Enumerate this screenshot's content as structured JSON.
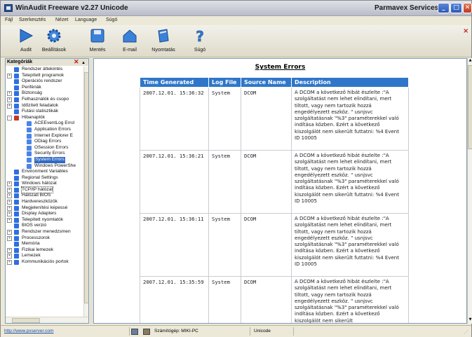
{
  "window": {
    "title": "WinAudit Freeware v2.27 Unicode",
    "vendor": "Parmavex Services",
    "buttons": {
      "minimize": "_",
      "maximize": "□",
      "close": "✕"
    }
  },
  "menu": [
    "Fájl",
    "Szerkesztés",
    "Nézet",
    "Language",
    "Súgó"
  ],
  "toolbar": {
    "items": [
      {
        "label": "Audit",
        "icon": "play-arrow-icon"
      },
      {
        "label": "Beállítások",
        "icon": "gear-icon"
      },
      {
        "label": "Mentés",
        "icon": "save-disk-icon"
      },
      {
        "label": "E-mail",
        "icon": "mail-house-icon"
      },
      {
        "label": "Nyomtatás",
        "icon": "printer-icon"
      },
      {
        "label": "Súgó",
        "icon": "help-question-icon"
      }
    ],
    "close_glyph": "×"
  },
  "sidebar": {
    "header": "Kategóriák",
    "close_glyph": "✕",
    "items": [
      {
        "label": "Rendszer áttekintés",
        "expander": ""
      },
      {
        "label": "Telepített programok",
        "expander": "+"
      },
      {
        "label": "Operációs rendszer",
        "expander": ""
      },
      {
        "label": "Perifériák",
        "expander": ""
      },
      {
        "label": "Biztonság",
        "expander": "+"
      },
      {
        "label": "Felhasználók és csopo",
        "expander": "+"
      },
      {
        "label": "Időzített feladatok",
        "expander": "+"
      },
      {
        "label": "Futási statisztikák",
        "expander": ""
      },
      {
        "label": "Hibanaplók",
        "expander": "-"
      },
      {
        "label": "ACEEventLog Errol",
        "expander": "",
        "indent": 1
      },
      {
        "label": "Application Errors",
        "expander": "",
        "indent": 1
      },
      {
        "label": "Internet Explorer E",
        "expander": "",
        "indent": 1
      },
      {
        "label": "ODiag Errors",
        "expander": "",
        "indent": 1
      },
      {
        "label": "OSession Errors",
        "expander": "",
        "indent": 1
      },
      {
        "label": "Security Errors",
        "expander": "",
        "indent": 1
      },
      {
        "label": "System Errors",
        "expander": "",
        "indent": 1,
        "selected": true
      },
      {
        "label": "Windows PowerShe",
        "expander": "",
        "indent": 1
      },
      {
        "label": "Environment Variables",
        "expander": ""
      },
      {
        "label": "Regional Settings",
        "expander": ""
      },
      {
        "label": "Windows hálózat",
        "expander": "+"
      },
      {
        "label": "TCP/IP hálózat",
        "expander": "+",
        "focused": true
      },
      {
        "label": "Hálózati BIOS",
        "expander": "+"
      },
      {
        "label": "Hardvereszközök",
        "expander": "+"
      },
      {
        "label": "Megjelenítési képessé",
        "expander": "+"
      },
      {
        "label": "Display Adapters",
        "expander": "+"
      },
      {
        "label": "Telepített nyomtatók",
        "expander": "+"
      },
      {
        "label": "BIOS verzió",
        "expander": ""
      },
      {
        "label": "Rendszer menedzsmen",
        "expander": "+"
      },
      {
        "label": "Processzorok",
        "expander": "+"
      },
      {
        "label": "Memória",
        "expander": ""
      },
      {
        "label": "Fizikai lemezek",
        "expander": "+"
      },
      {
        "label": "Lemezek",
        "expander": "+"
      },
      {
        "label": "Kommunikációs portok",
        "expander": "+"
      }
    ]
  },
  "main": {
    "title": "System Errors",
    "columns": [
      "Time Generated",
      "Log File",
      "Source Name",
      "Description"
    ],
    "rows": [
      {
        "time": "2007.12.01. 15:36:32",
        "log": "System",
        "source": "DCOM",
        "desc": "A DCOM a következő hibát észlelte :\"A szolgáltatást nem lehet elindítani, mert tiltott, vagy nem tartozik hozzá engedélyezett eszköz. \" usnjsvc szolgáltatásnak \"%3\" paraméterekkel való indítása közben. Ezért a következő kiszolgálót nem sikerült futtatni: %4 Event ID 10005"
      },
      {
        "time": "2007.12.01. 15:36:21",
        "log": "System",
        "source": "DCOM",
        "desc": "A DCOM a következő hibát észlelte :\"A szolgáltatást nem lehet elindítani, mert tiltott, vagy nem tartozik hozzá engedélyezett eszköz. \" usnjsvc szolgáltatásnak \"%3\" paraméterekkel való indítása közben. Ezért a következő kiszolgálót nem sikerült futtatni: %4 Event ID 10005"
      },
      {
        "time": "2007.12.01. 15:36:11",
        "log": "System",
        "source": "DCOM",
        "desc": "A DCOM a következő hibát észlelte :\"A szolgáltatást nem lehet elindítani, mert tiltott, vagy nem tartozik hozzá engedélyezett eszköz. \" usnjsvc szolgáltatásnak \"%3\" paraméterekkel való indítása közben. Ezért a következő kiszolgálót nem sikerült futtatni: %4 Event ID 10005"
      },
      {
        "time": "2007.12.01. 15:35:59",
        "log": "System",
        "source": "DCOM",
        "desc": "A DCOM a következő hibát észlelte :\"A szolgáltatást nem lehet elindítani, mert tiltott, vagy nem tartozik hozzá engedélyezett eszköz. \" usnjsvc szolgáltatásnak \"%3\" paraméterekkel való indítása közben. Ezért a következő kiszolgálót nem sikerült"
      }
    ]
  },
  "status": {
    "link": "http://www.pxserver.com",
    "computer": "Számítógép: MIKI-PC",
    "encoding": "Unicode"
  },
  "colors": {
    "header_blue": "#2f76c9",
    "selection": "#316ac5"
  }
}
